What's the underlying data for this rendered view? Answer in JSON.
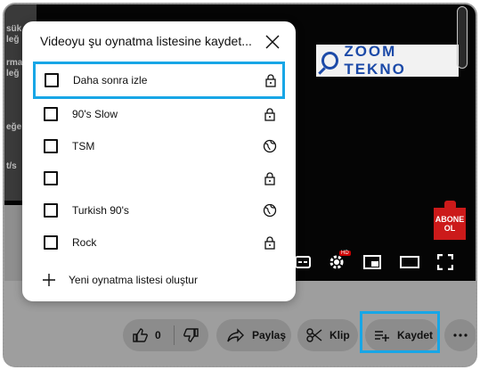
{
  "dialog": {
    "title": "Videoyu şu oynatma listesine kaydet...",
    "playlists": [
      {
        "name": "Daha sonra izle",
        "privacy": "lock-icon",
        "selected": true
      },
      {
        "name": "90's Slow",
        "privacy": "lock-icon",
        "selected": false
      },
      {
        "name": "TSM",
        "privacy": "globe-icon",
        "selected": false
      },
      {
        "name": "",
        "privacy": "lock-icon",
        "selected": false
      },
      {
        "name": "Turkish 90's",
        "privacy": "globe-icon",
        "selected": false
      },
      {
        "name": "Rock",
        "privacy": "lock-icon",
        "selected": false
      }
    ],
    "create_label": "Yeni oynatma listesi oluştur"
  },
  "video": {
    "watermark": "ZOOM TEKNO",
    "subscribe_badge": [
      "ABONE",
      "OL"
    ],
    "settings_badge": "HD"
  },
  "actions": {
    "like_count": "0",
    "share_label": "Paylaş",
    "clip_label": "Klip",
    "save_label": "Kaydet"
  },
  "colors": {
    "highlight": "#18a6e6",
    "action_pill": "#8c8c8c",
    "dialog_bg": "#ffffff"
  }
}
